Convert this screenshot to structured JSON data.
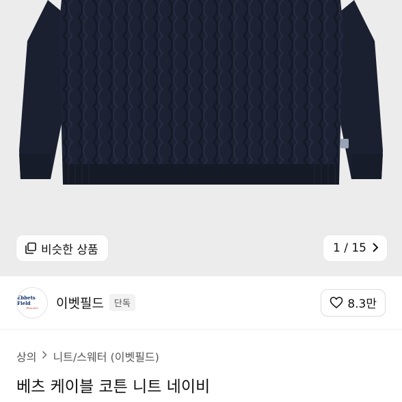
{
  "hero": {
    "image_icon": "navy-cable-knit-sweater-photo",
    "similar_label": "비슷한 상품",
    "similar_icon": "copy-icon",
    "counter": "1 / 15",
    "next_icon": "chevron-right-icon"
  },
  "seller": {
    "name": "이벳필드",
    "badge": "단독",
    "logo_main": "Ebbets Field",
    "logo_sub": "Flannels",
    "like_icon": "heart-icon",
    "like_count": "8.3만"
  },
  "breadcrumb": {
    "items": [
      "상의",
      "니트/스웨터 (이벳필드)"
    ],
    "separator_icon": "chevron-right-icon"
  },
  "product": {
    "title": "베츠 케이블 코튼 니트 네이비"
  },
  "colors": {
    "sweater": "#1c2233",
    "hero_bg": "#ececec"
  }
}
